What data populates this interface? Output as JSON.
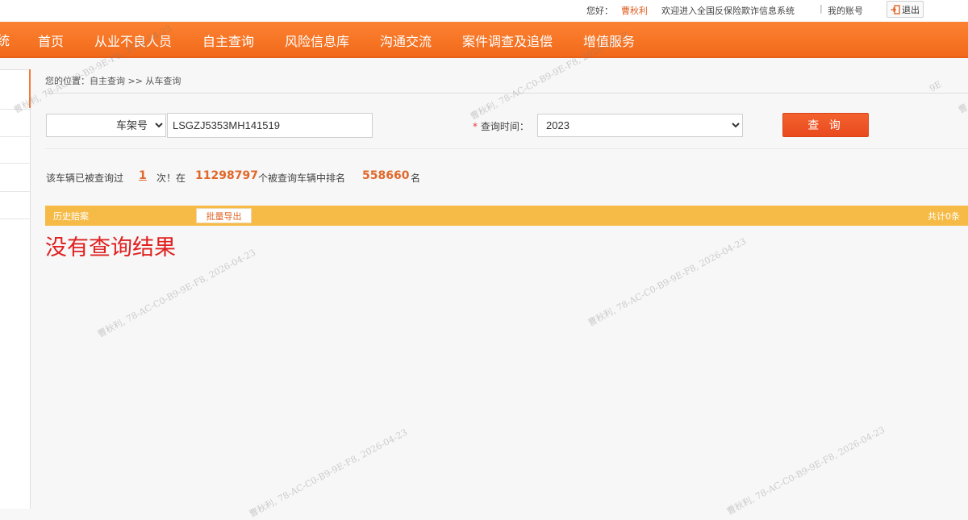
{
  "topbar": {
    "greeting": "您好：",
    "username": "曹秋利",
    "welcome": "欢迎进入全国反保险欺诈信息系统",
    "separator": "|",
    "my_account": "我的账号",
    "logout": "退出"
  },
  "nav": {
    "logo_fragment": "统",
    "items": [
      "首页",
      "从业不良人员",
      "自主查询",
      "风险信息库",
      "沟通交流",
      "案件调查及追偿",
      "增值服务"
    ]
  },
  "breadcrumb": "您的位置：自主查询 >> 从车查询",
  "search": {
    "type_options": [
      "车架号"
    ],
    "type_selected": "车架号",
    "vin_value": "LSGZJ5353MH141519",
    "time_required_mark": "*",
    "time_label": "查询时间：",
    "year_options": [
      "2023"
    ],
    "year_selected": "2023",
    "button": "查 询"
  },
  "stats": {
    "prefix": "该车辆已被查询过",
    "times": "1",
    "middle": "次！在",
    "total_vehicles": "11298797",
    "rank_text": "个被查询车辆中排名",
    "rank": "558660",
    "suffix": "名"
  },
  "history": {
    "title": "历史赔案",
    "export": "批量导出",
    "total": "共计0条"
  },
  "no_result": "没有查询结果",
  "watermark": "曹秋利, 78-AC-C0-B9-9E-F8, 2026-04-23",
  "watermark_frag_1": "9E",
  "watermark_frag_2": "曹",
  "colors": {
    "nav_orange": "#f47421",
    "accent_red": "#e94a1e",
    "bar_yellow": "#f6bb47",
    "error_red": "#e02020"
  }
}
